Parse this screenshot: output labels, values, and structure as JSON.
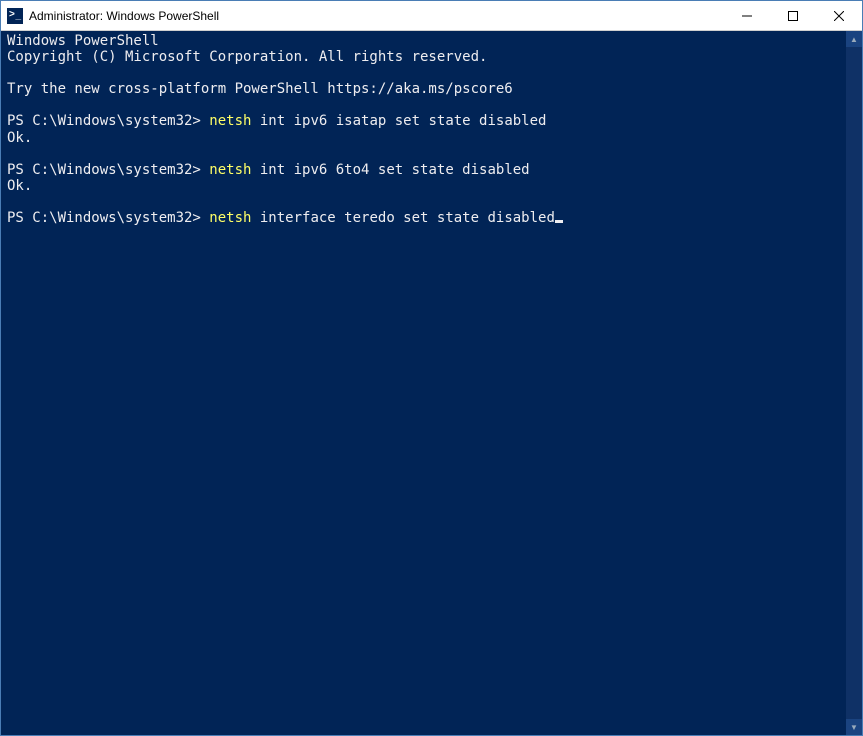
{
  "window": {
    "title": "Administrator: Windows PowerShell"
  },
  "terminal": {
    "header_line1": "Windows PowerShell",
    "header_line2": "Copyright (C) Microsoft Corporation. All rights reserved.",
    "hint": "Try the new cross-platform PowerShell https://aka.ms/pscore6",
    "blocks": [
      {
        "prompt": "PS C:\\Windows\\system32> ",
        "cmd_hl": "netsh",
        "cmd_rest": " int ipv6 isatap set state disabled",
        "output": "Ok."
      },
      {
        "prompt": "PS C:\\Windows\\system32> ",
        "cmd_hl": "netsh",
        "cmd_rest": " int ipv6 6to4 set state disabled",
        "output": "Ok."
      },
      {
        "prompt": "PS C:\\Windows\\system32> ",
        "cmd_hl": "netsh",
        "cmd_rest": " interface teredo set state disabled",
        "output": null
      }
    ]
  }
}
